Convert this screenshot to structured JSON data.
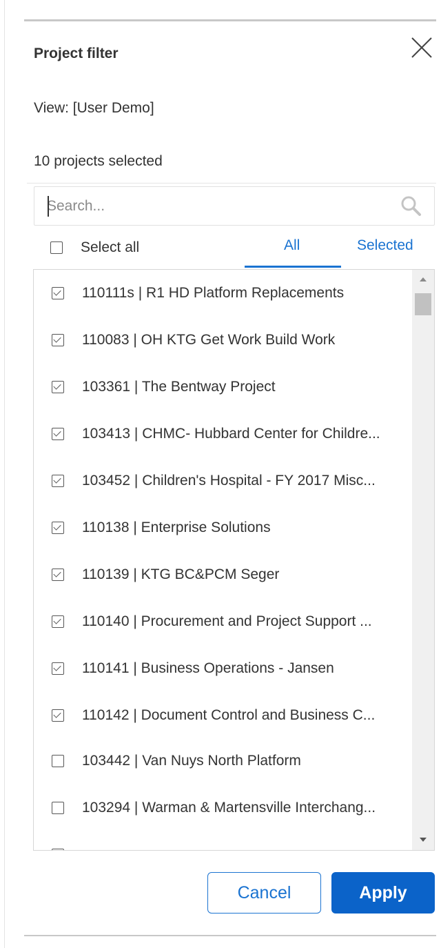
{
  "dialog": {
    "title": "Project filter",
    "view_label": "View: [User Demo]",
    "selected_count_text": "10 projects selected"
  },
  "search": {
    "placeholder": "Search...",
    "value": ""
  },
  "select_all": {
    "label": "Select all",
    "checked": false
  },
  "tabs": [
    {
      "label": "All",
      "active": true
    },
    {
      "label": "Selected",
      "active": false
    }
  ],
  "projects": [
    {
      "label": "110111s | R1 HD Platform Replacements",
      "checked": true
    },
    {
      "label": "110083 | OH KTG Get Work Build Work",
      "checked": true
    },
    {
      "label": "103361 | The Bentway Project",
      "checked": true
    },
    {
      "label": "103413 | CHMC- Hubbard Center for Childre...",
      "checked": true
    },
    {
      "label": "103452 | Children's Hospital - FY 2017 Misc...",
      "checked": true
    },
    {
      "label": "110138 | Enterprise Solutions",
      "checked": true
    },
    {
      "label": "110139 | KTG BC&PCM Seger",
      "checked": true
    },
    {
      "label": "110140 | Procurement and Project Support ...",
      "checked": true
    },
    {
      "label": "110141 | Business Operations - Jansen",
      "checked": true
    },
    {
      "label": "110142 | Document Control and Business C...",
      "checked": true
    },
    {
      "label": "103442 | Van Nuys North Platform",
      "checked": false
    },
    {
      "label": "103294 | Warman & Martensville Interchang...",
      "checked": false
    },
    {
      "label": "",
      "checked": false
    }
  ],
  "buttons": {
    "cancel_label": "Cancel",
    "apply_label": "Apply"
  },
  "icons": {
    "close": "close-icon",
    "search": "search-icon",
    "scroll_up": "scroll-up-arrow-icon",
    "scroll_down": "scroll-down-arrow-icon"
  },
  "colors": {
    "accent": "#1a73d1",
    "primary_button": "#0b63c9",
    "text": "#333333"
  }
}
